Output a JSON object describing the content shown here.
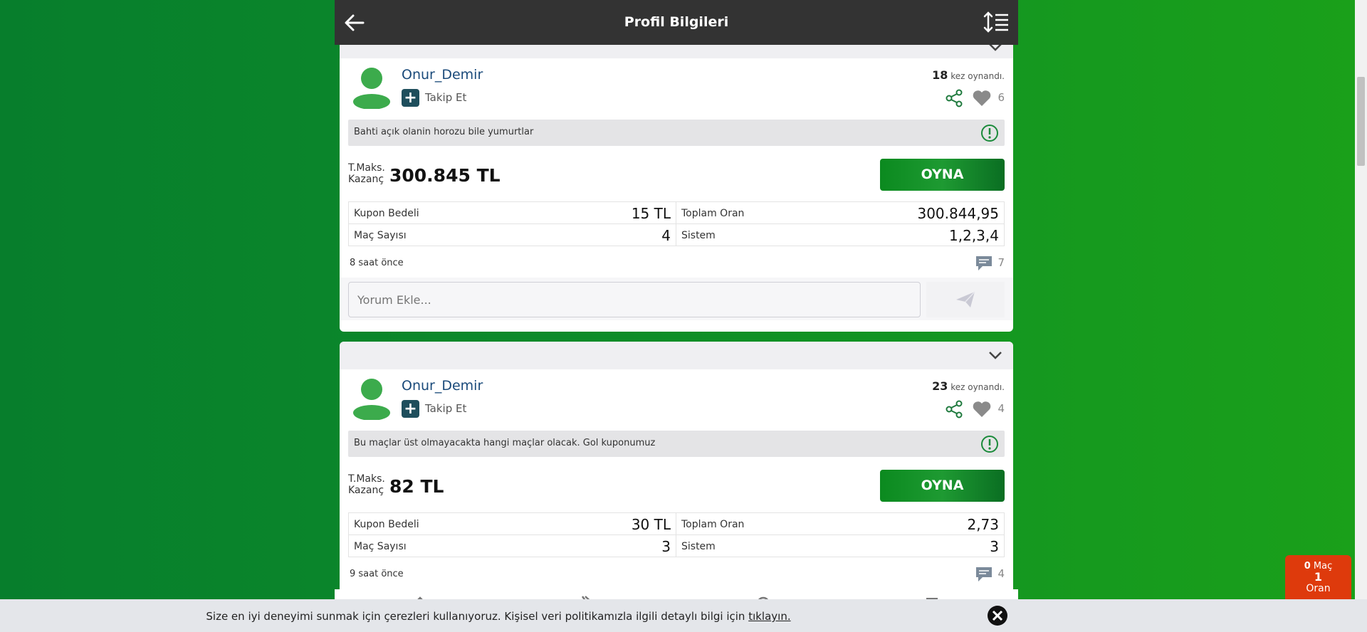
{
  "header": {
    "title": "Profil Bilgileri"
  },
  "cards": [
    {
      "username": "Onur_Demir",
      "follow_label": "Takip Et",
      "played_count": "18",
      "played_suffix": "kez oynandı.",
      "likes": "6",
      "description": "Bahti açık olanin horozu bile yumurtlar",
      "kazanc_label": "T.Maks. Kazanç",
      "kazanc_value": "300.845 TL",
      "play_label": "OYNA",
      "stats": [
        {
          "label": "Kupon Bedeli",
          "value": "15 TL"
        },
        {
          "label": "Toplam Oran",
          "value": "300.844,95"
        },
        {
          "label": "Maç Sayısı",
          "value": "4"
        },
        {
          "label": "Sistem",
          "value": "1,2,3,4"
        }
      ],
      "time_ago": "8 saat önce",
      "comment_count": "7",
      "comment_placeholder": "Yorum Ekle..."
    },
    {
      "username": "Onur_Demir",
      "follow_label": "Takip Et",
      "played_count": "23",
      "played_suffix": "kez oynandı.",
      "likes": "4",
      "description": "Bu maçlar üst olmayacakta hangi maçlar olacak. Gol kuponumuz",
      "kazanc_label": "T.Maks. Kazanç",
      "kazanc_value": "82 TL",
      "play_label": "OYNA",
      "stats": [
        {
          "label": "Kupon Bedeli",
          "value": "30 TL"
        },
        {
          "label": "Toplam Oran",
          "value": "2,73"
        },
        {
          "label": "Maç Sayısı",
          "value": "3"
        },
        {
          "label": "Sistem",
          "value": "3"
        }
      ],
      "time_ago": "9 saat önce",
      "comment_count": "4"
    }
  ],
  "cookie": {
    "text": "Size en iyi deneyimi sunmak için çerezleri kullanıyoruz. Kişisel veri politikamızla ilgili detaylı bilgi için",
    "link": "tıklayın."
  },
  "mac_widget": {
    "mac_count": "0",
    "mac_label": "Maç",
    "oran_value": "1",
    "oran_label": "Oran"
  },
  "colors": {
    "accent_green": "#0b8a1f",
    "header_bg": "#333333",
    "widget_red": "#de3a0c"
  }
}
